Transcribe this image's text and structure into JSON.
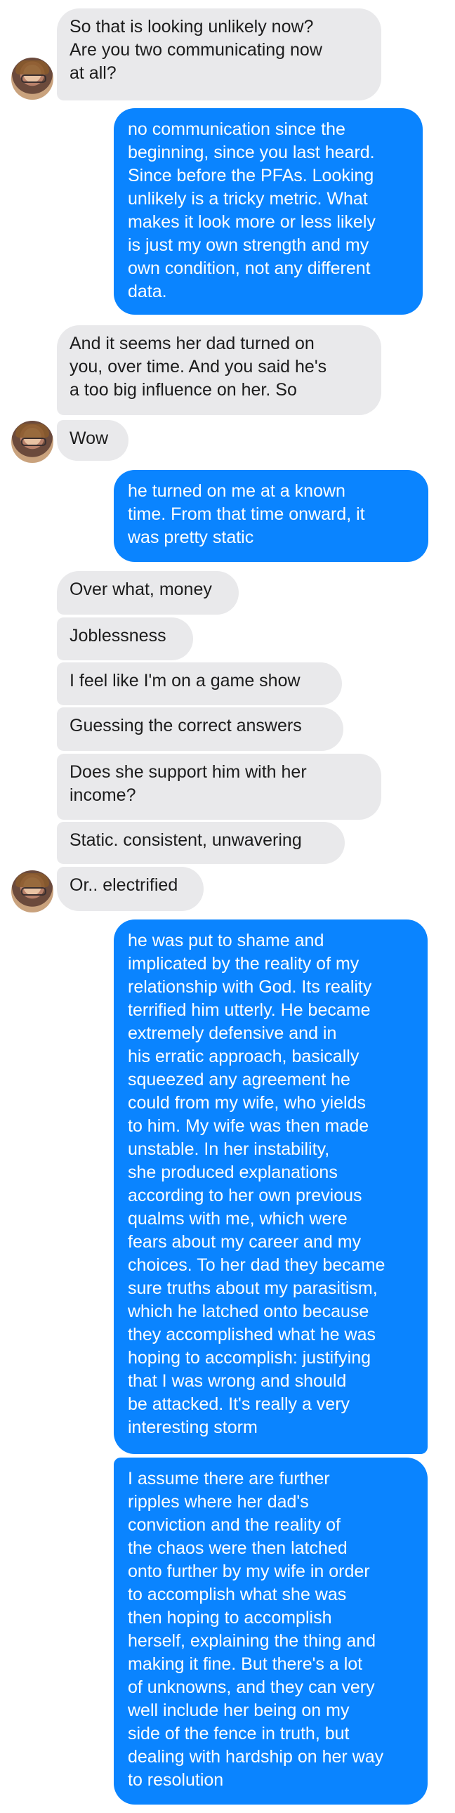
{
  "conversation": {
    "messages": [
      {
        "from": "contact",
        "text": "So that is looking unlikely now?\nAre you two communicating now\nat all?"
      },
      {
        "from": "me",
        "text": "no communication since the\nbeginning, since you last heard.\nSince before the PFAs. Looking\nunlikely is a tricky metric. What\nmakes it look more or less likely\nis just my own strength and my\nown condition, not any different\ndata."
      },
      {
        "from": "contact",
        "text": "And it seems her dad turned on\nyou, over time. And you said he's\na too big influence on her. So"
      },
      {
        "from": "contact",
        "text": "Wow"
      },
      {
        "from": "me",
        "text": "he turned on me at a known\ntime. From that time onward, it\nwas pretty static"
      },
      {
        "from": "contact",
        "text": "Over what, money"
      },
      {
        "from": "contact",
        "text": "Joblessness"
      },
      {
        "from": "contact",
        "text": "I feel like I'm on a game show"
      },
      {
        "from": "contact",
        "text": "Guessing the correct answers"
      },
      {
        "from": "contact",
        "text": "Does she support him with her\nincome?"
      },
      {
        "from": "contact",
        "text": "Static. consistent, unwavering"
      },
      {
        "from": "contact",
        "text": "Or.. electrified"
      },
      {
        "from": "me",
        "text": "he was put to shame and\nimplicated by the reality of my\nrelationship with God. Its reality\nterrified him utterly. He became\nextremely defensive and in\nhis erratic approach, basically\nsqueezed any agreement he\ncould from my wife, who yields\nto him. My wife was then made\nunstable. In her instability,\nshe produced explanations\naccording to her own previous\nqualms with me, which were\nfears about my career and my\nchoices. To her dad they became\nsure truths about my parasitism,\nwhich he latched onto because\nthey accomplished what he was\nhoping to accomplish: justifying\nthat I was wrong and should\nbe attacked. It's really a very\ninteresting storm"
      },
      {
        "from": "me",
        "text": "I assume there are further\nripples where her dad's\nconviction and the reality of\nthe chaos were then latched\nonto further by my wife in order\nto accomplish what she was\nthen hoping to accomplish\nherself, explaining the thing and\nmaking it fine. But there's a lot\nof unknowns, and they can very\nwell include her being on my\nside of the fence in truth, but\ndealing with hardship on her way\nto resolution"
      }
    ]
  },
  "colors": {
    "incoming_bubble": "#e9e9eb",
    "outgoing_bubble": "#0a84ff",
    "incoming_text": "#1c1c1c",
    "outgoing_text": "#ffffff"
  }
}
